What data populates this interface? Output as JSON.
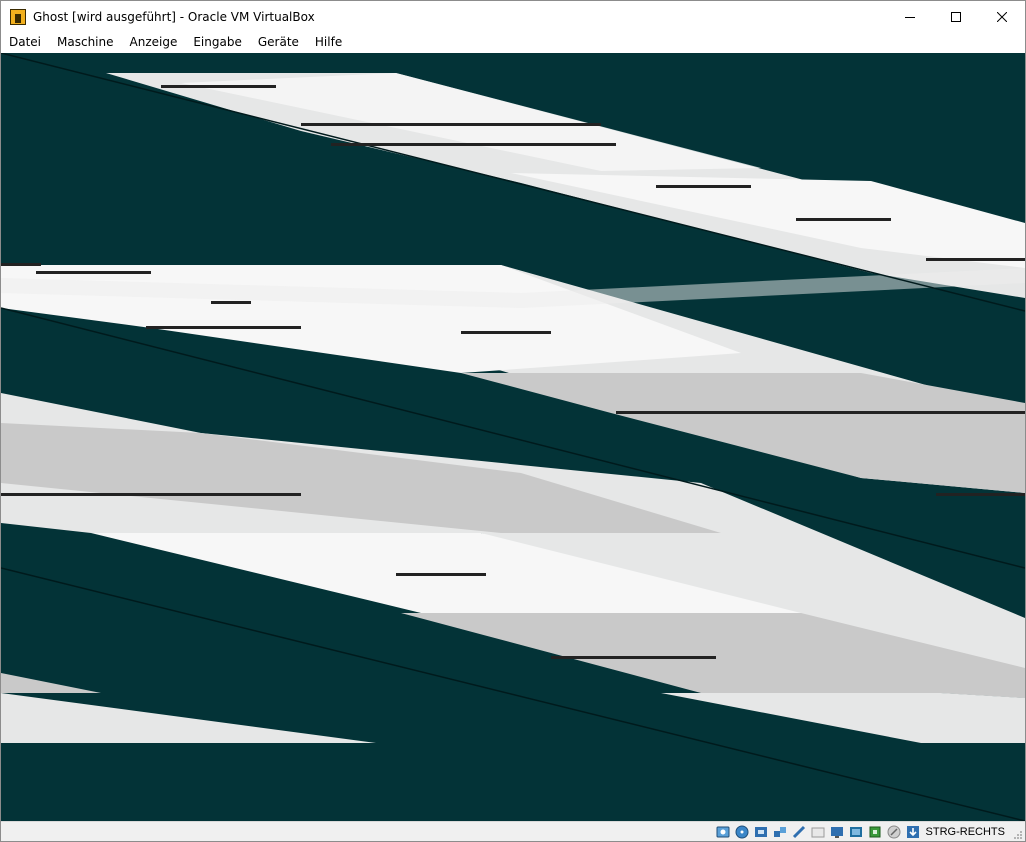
{
  "window": {
    "title": "Ghost [wird ausgeführt] - Oracle VM VirtualBox"
  },
  "menu": {
    "items": [
      {
        "label": "Datei"
      },
      {
        "label": "Maschine"
      },
      {
        "label": "Anzeige"
      },
      {
        "label": "Eingabe"
      },
      {
        "label": "Geräte"
      },
      {
        "label": "Hilfe"
      }
    ]
  },
  "vm": {
    "state": "running",
    "display_colors": {
      "background": "#033337",
      "band_light": "#f7f7f7",
      "band_mid": "#e6e7e7",
      "band_gray": "#c9c9c9"
    }
  },
  "statusbar": {
    "icons": [
      "hard-disk-icon",
      "optical-drive-icon",
      "audio-icon",
      "network-icon",
      "usb-icon",
      "shared-folders-icon",
      "display-icon",
      "recording-icon",
      "cpu-icon",
      "mouse-integration-icon",
      "keyboard-capture-icon"
    ],
    "host_key": "STRG-RECHTS"
  }
}
